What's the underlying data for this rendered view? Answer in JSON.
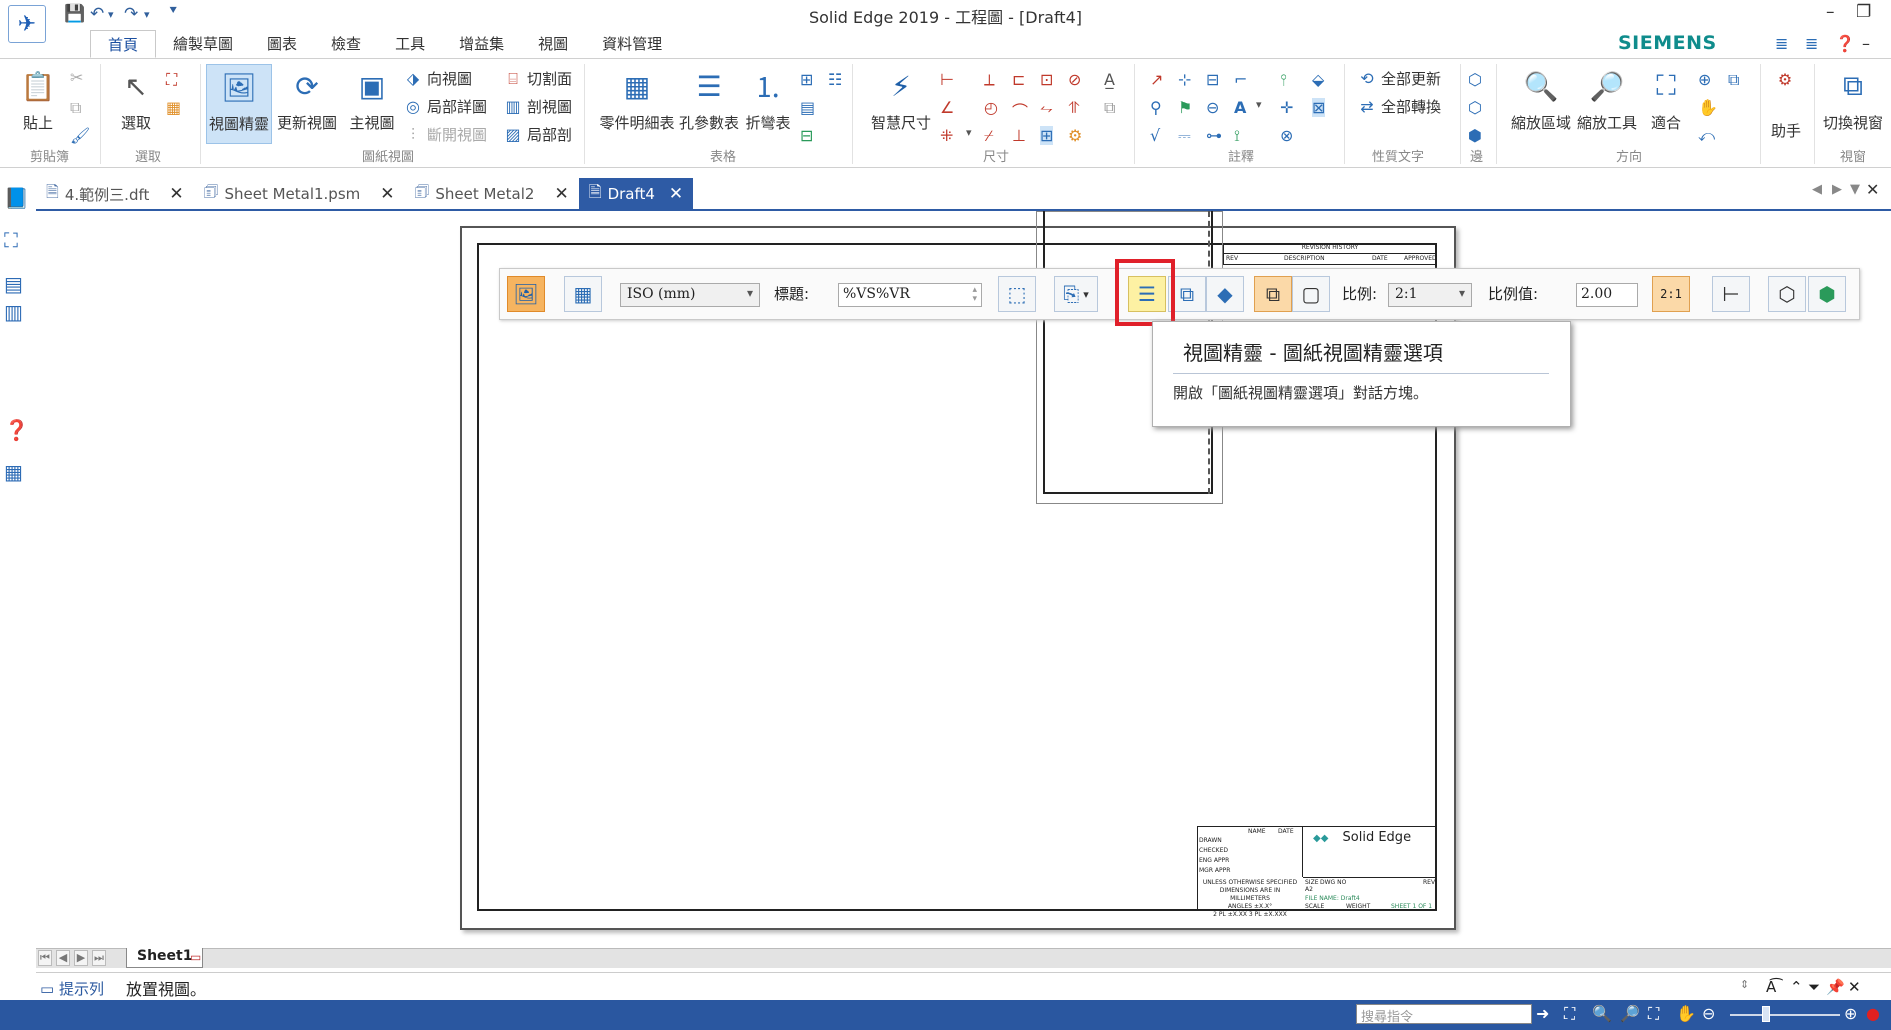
{
  "window": {
    "title": "Solid Edge 2019 - 工程圖 - [Draft4]",
    "brand": "SIEMENS",
    "brand_color": "#0f8c8c",
    "accent": "#2e5ba5"
  },
  "ribbon": {
    "tabs": [
      "首頁",
      "繪製草圖",
      "圖表",
      "檢查",
      "工具",
      "增益集",
      "視圖",
      "資料管理"
    ],
    "active_tab": "首頁",
    "groups": {
      "clipboard": {
        "label": "剪貼簿",
        "paste": "貼上"
      },
      "select": {
        "label": "選取",
        "select": "選取"
      },
      "drawing_views": {
        "label": "圖紙視圖",
        "view_wizard": "視圖精靈",
        "update_views": "更新視圖",
        "principal": "主視圖",
        "auxiliary": "向視圖",
        "detail": "局部詳圖",
        "broken": "斷開視圖",
        "section_plane": "切割面",
        "section": "剖視圖",
        "broken_out": "局部剖"
      },
      "tables": {
        "label": "表格",
        "parts_list": "零件明細表",
        "hole_table": "孔參數表",
        "bend_table": "折彎表"
      },
      "dimension": {
        "label": "尺寸",
        "smart_dimension": "智慧尺寸"
      },
      "annotation": {
        "label": "註釋"
      },
      "property_text": {
        "label": "性質文字",
        "update_all": "全部更新",
        "convert_all": "全部轉換"
      },
      "edges": {
        "label": "邊"
      },
      "orient": {
        "label": "方向",
        "zoom_area": "縮放區域",
        "zoom_tool": "縮放工具",
        "fit": "適合"
      },
      "assistant": {
        "label": "助手"
      },
      "window": {
        "label": "視窗",
        "switch_windows": "切換視窗"
      }
    }
  },
  "doc_tabs": [
    {
      "label": "4.範例三.dft",
      "active": false
    },
    {
      "label": "Sheet Metal1.psm",
      "active": false
    },
    {
      "label": "Sheet Metal2",
      "active": false
    },
    {
      "label": "Draft4",
      "active": true
    }
  ],
  "command_bar": {
    "standard": "ISO (mm)",
    "caption_label": "標題:",
    "caption_value": "%VS%VR",
    "scale_label": "比例:",
    "scale_value": "2:1",
    "scale_value_label": "比例值:",
    "scale_number": "2.00",
    "scale_button": "2:1"
  },
  "tooltip": {
    "title": "視圖精靈 - 圖紙視圖精靈選項",
    "description": "開啟「圖紙視圖精靈選項」對話方塊。"
  },
  "drawing": {
    "title_block_logo": "Solid Edge",
    "revision_history": "REVISION HISTORY",
    "rev_cols": [
      "REV",
      "DESCRIPTION",
      "DATE",
      "APPROVED"
    ],
    "tb_rows": [
      "DRAWN",
      "CHECKED",
      "ENG APPR",
      "MGR APPR"
    ],
    "tb_cols": [
      "NAME",
      "DATE"
    ],
    "tb_note1": "UNLESS OTHERWISE SPECIFIED",
    "tb_note2": "DIMENSIONS ARE IN MILLIMETERS",
    "tb_note3": "ANGLES ±X.X°",
    "tb_note4": "2 PL ±X.XX 3 PL ±X.XXX",
    "tb_size": "SIZE",
    "tb_dwg_no": "DWG NO",
    "tb_rev": "REV",
    "tb_size_val": "A2",
    "tb_file_name": "FILE NAME: Draft4",
    "tb_scale": "SCALE",
    "tb_weight": "WEIGHT",
    "tb_sheet": "SHEET 1 OF 1"
  },
  "sheet_tabs": {
    "active": "Sheet1"
  },
  "prompt": {
    "label": "提示列",
    "text": "放置視圖。"
  },
  "status": {
    "command_search_placeholder": "搜尋指令"
  }
}
